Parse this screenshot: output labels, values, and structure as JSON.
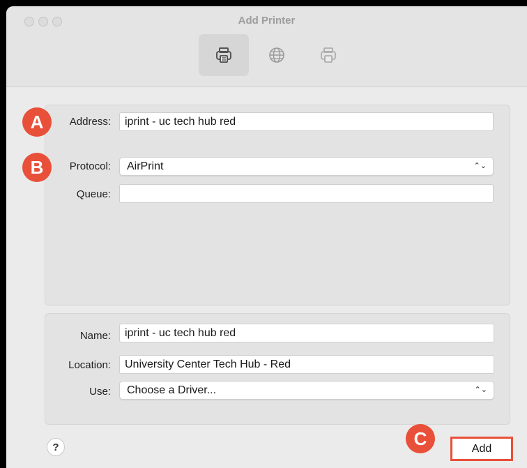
{
  "window": {
    "title": "Add Printer"
  },
  "toolbar": {
    "items": [
      {
        "icon": "printer-icon",
        "active": true
      },
      {
        "icon": "globe-icon",
        "active": false
      },
      {
        "icon": "printer-outline-icon",
        "active": false
      }
    ]
  },
  "connection": {
    "address_label": "Address:",
    "address_value": "iprint - uc tech hub red",
    "protocol_label": "Protocol:",
    "protocol_value": "AirPrint",
    "queue_label": "Queue:",
    "queue_value": ""
  },
  "details": {
    "name_label": "Name:",
    "name_value": "iprint - uc tech hub red",
    "location_label": "Location:",
    "location_value": "University Center Tech Hub - Red",
    "use_label": "Use:",
    "use_value": "Choose a Driver..."
  },
  "annotations": {
    "a": "A",
    "b": "B",
    "c": "C"
  },
  "footer": {
    "help_label": "?",
    "add_label": "Add"
  },
  "colors": {
    "annotation": "#e8503a",
    "window_bg": "#ebebeb",
    "frame": "#000000"
  }
}
